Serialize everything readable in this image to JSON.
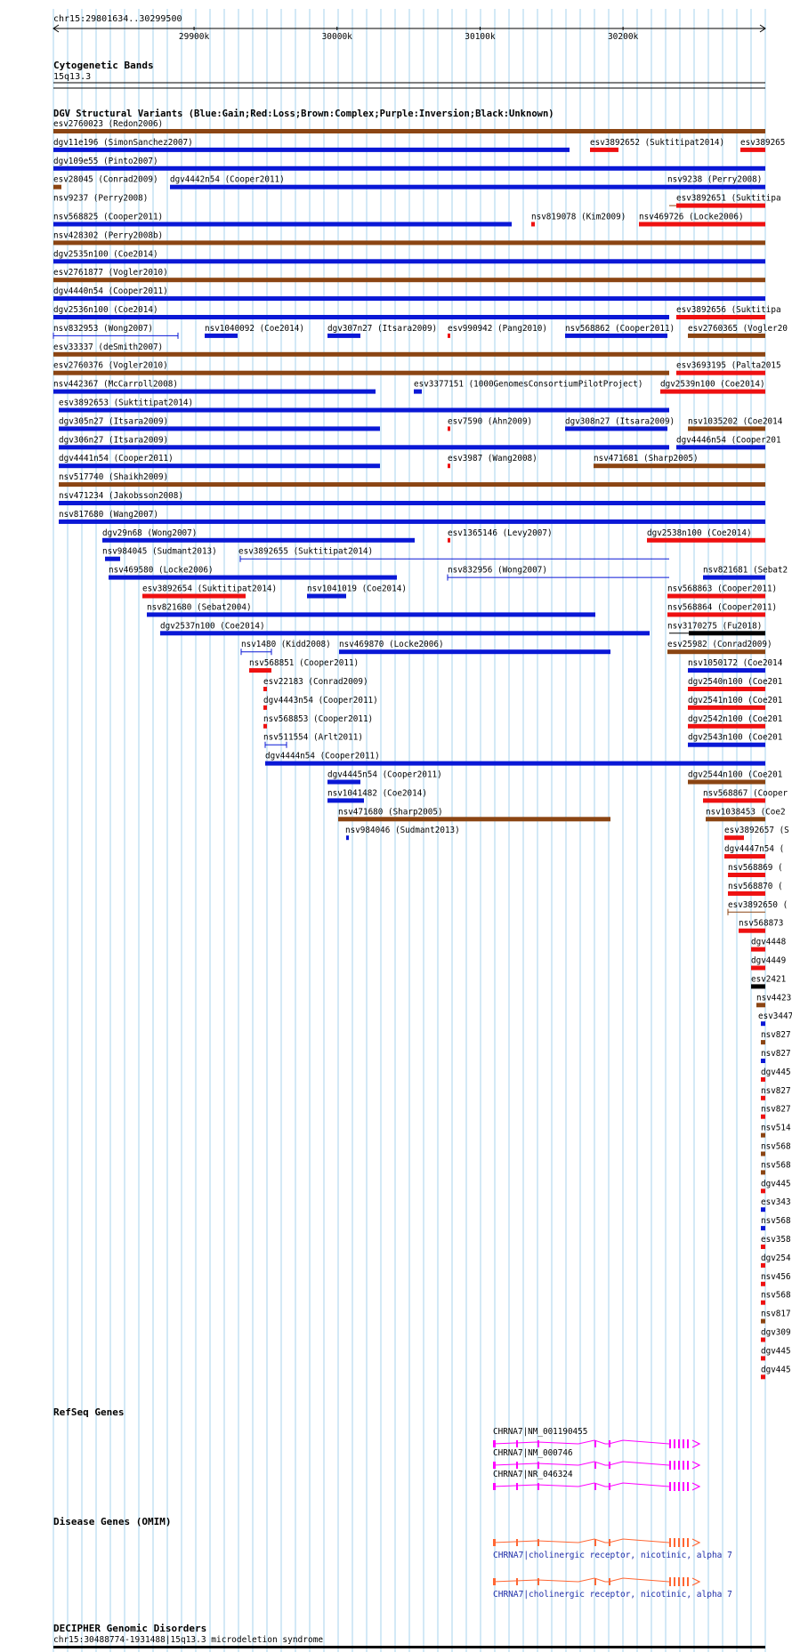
{
  "ruler": {
    "position_label": "chr15:29801634..30299500",
    "ticks": [
      {
        "label": "29900k",
        "value": 29900000
      },
      {
        "label": "30000k",
        "value": 30000000
      },
      {
        "label": "30100k",
        "value": 30100000
      },
      {
        "label": "30200k",
        "value": 30200000
      }
    ]
  },
  "tracks": {
    "cytoband": {
      "title": "Cytogenetic Bands",
      "label": "15q13.3"
    },
    "dgv": {
      "title": "DGV Structural Variants (Blue:Gain;Red:Loss;Brown:Complex;Purple:Inversion;Black:Unknown)"
    },
    "refseq": {
      "title": "RefSeq Genes"
    },
    "omim": {
      "title": "Disease Genes (OMIM)"
    },
    "decipher": {
      "title": "DECIPHER Genomic Disorders",
      "label": "chr15:30488774-1931488|15q13.3 microdeletion syndrome"
    }
  },
  "colors": {
    "gain": "#0a18d6",
    "loss": "#ee1111",
    "complex": "#8b4513",
    "unknown": "#000000",
    "refseq": "#ff00ff",
    "omim": "#ff6633",
    "omim_label": "#1f2fa8"
  },
  "variants": [
    {
      "label": "esv2760023 (Redon2006)",
      "type": "complex"
    },
    {
      "label": "dgv11e196 (SimonSanchez2007)",
      "type": "gain"
    },
    {
      "label": "esv3892652 (Suktitipat2014)",
      "type": "loss"
    },
    {
      "label": "esv389265",
      "type": "loss"
    },
    {
      "label": "dgv109e55 (Pinto2007)",
      "type": "gain"
    },
    {
      "label": "esv28045 (Conrad2009)",
      "type": "complex"
    },
    {
      "label": "dgv4442n54 (Cooper2011)",
      "type": "gain"
    },
    {
      "label": "nsv9238 (Perry2008)",
      "type": "gain"
    },
    {
      "label": "nsv9237 (Perry2008)",
      "type": "complex"
    },
    {
      "label": "esv3892651 (Suktitipa",
      "type": "loss"
    },
    {
      "label": "nsv568825 (Cooper2011)",
      "type": "gain"
    },
    {
      "label": "nsv819078 (Kim2009)",
      "type": "loss"
    },
    {
      "label": "nsv469726 (Locke2006)",
      "type": "loss"
    },
    {
      "label": "nsv428302 (Perry2008b)",
      "type": "complex"
    },
    {
      "label": "dgv2535n100 (Coe2014)",
      "type": "gain"
    },
    {
      "label": "esv2761877 (Vogler2010)",
      "type": "complex"
    },
    {
      "label": "dgv4440n54 (Cooper2011)",
      "type": "gain"
    },
    {
      "label": "dgv2536n100 (Coe2014)",
      "type": "gain"
    },
    {
      "label": "esv3892656 (Suktitipa",
      "type": "loss"
    },
    {
      "label": "nsv832953 (Wong2007)",
      "type": "gain"
    },
    {
      "label": "nsv1040092 (Coe2014)",
      "type": "gain"
    },
    {
      "label": "dgv307n27 (Itsara2009)",
      "type": "gain"
    },
    {
      "label": "esv990942 (Pang2010)",
      "type": "loss"
    },
    {
      "label": "nsv568862 (Cooper2011)",
      "type": "gain"
    },
    {
      "label": "esv2760365 (Vogler20",
      "type": "complex"
    },
    {
      "label": "esv33337 (deSmith2007)",
      "type": "complex"
    },
    {
      "label": "esv2760376 (Vogler2010)",
      "type": "complex"
    },
    {
      "label": "esv3693195 (Palta2015",
      "type": "loss"
    },
    {
      "label": "nsv442367 (McCarroll2008)",
      "type": "gain"
    },
    {
      "label": "esv3377151 (1000GenomesConsortiumPilotProject)",
      "type": "gain"
    },
    {
      "label": "dgv2539n100 (Coe2014)",
      "type": "loss"
    },
    {
      "label": "esv3892653 (Suktitipat2014)",
      "type": "gain"
    },
    {
      "label": "dgv305n27 (Itsara2009)",
      "type": "gain"
    },
    {
      "label": "esv7590 (Ahn2009)",
      "type": "loss"
    },
    {
      "label": "dgv308n27 (Itsara2009)",
      "type": "gain"
    },
    {
      "label": "nsv1035202 (Coe2014",
      "type": "complex"
    },
    {
      "label": "dgv306n27 (Itsara2009)",
      "type": "gain"
    },
    {
      "label": "dgv4446n54 (Cooper201",
      "type": "gain"
    },
    {
      "label": "dgv4441n54 (Cooper2011)",
      "type": "gain"
    },
    {
      "label": "esv3987 (Wang2008)",
      "type": "loss"
    },
    {
      "label": "nsv471681 (Sharp2005)",
      "type": "complex"
    },
    {
      "label": "nsv517740 (Shaikh2009)",
      "type": "complex"
    },
    {
      "label": "nsv471234 (Jakobsson2008)",
      "type": "gain"
    },
    {
      "label": "nsv817680 (Wang2007)",
      "type": "gain"
    },
    {
      "label": "dgv29n68 (Wong2007)",
      "type": "gain"
    },
    {
      "label": "esv1365146 (Levy2007)",
      "type": "loss"
    },
    {
      "label": "dgv2538n100 (Coe2014)",
      "type": "loss"
    },
    {
      "label": "nsv984045 (Sudmant2013)",
      "type": "gain"
    },
    {
      "label": "esv3892655 (Suktitipat2014)",
      "type": "gain"
    },
    {
      "label": "nsv469580 (Locke2006)",
      "type": "gain"
    },
    {
      "label": "nsv832956 (Wong2007)",
      "type": "gain"
    },
    {
      "label": "nsv821681 (Sebat2",
      "type": "gain"
    },
    {
      "label": "esv3892654 (Suktitipat2014)",
      "type": "loss"
    },
    {
      "label": "nsv1041019 (Coe2014)",
      "type": "gain"
    },
    {
      "label": "nsv568863 (Cooper2011)",
      "type": "loss"
    },
    {
      "label": "nsv821680 (Sebat2004)",
      "type": "gain"
    },
    {
      "label": "nsv568864 (Cooper2011)",
      "type": "loss"
    },
    {
      "label": "dgv2537n100 (Coe2014)",
      "type": "gain"
    },
    {
      "label": "nsv3170275 (Fu2018)",
      "type": "unknown"
    },
    {
      "label": "nsv1480 (Kidd2008)",
      "type": "gain"
    },
    {
      "label": "nsv469870 (Locke2006)",
      "type": "gain"
    },
    {
      "label": "esv25982 (Conrad2009)",
      "type": "complex"
    },
    {
      "label": "nsv568851 (Cooper2011)",
      "type": "loss"
    },
    {
      "label": "nsv1050172 (Coe2014",
      "type": "gain"
    },
    {
      "label": "esv22183 (Conrad2009)",
      "type": "loss"
    },
    {
      "label": "dgv2540n100 (Coe201",
      "type": "loss"
    },
    {
      "label": "dgv4443n54 (Cooper2011)",
      "type": "loss"
    },
    {
      "label": "dgv2541n100 (Coe201",
      "type": "loss"
    },
    {
      "label": "nsv568853 (Cooper2011)",
      "type": "loss"
    },
    {
      "label": "dgv2542n100 (Coe201",
      "type": "loss"
    },
    {
      "label": "nsv511554 (Arlt2011)",
      "type": "gain"
    },
    {
      "label": "dgv2543n100 (Coe201",
      "type": "gain"
    },
    {
      "label": "dgv4444n54 (Cooper2011)",
      "type": "gain"
    },
    {
      "label": "dgv4445n54 (Cooper2011)",
      "type": "gain"
    },
    {
      "label": "dgv2544n100 (Coe201",
      "type": "complex"
    },
    {
      "label": "nsv1041482 (Coe2014)",
      "type": "gain"
    },
    {
      "label": "nsv568867 (Cooper",
      "type": "loss"
    },
    {
      "label": "nsv471680 (Sharp2005)",
      "type": "complex"
    },
    {
      "label": "nsv1038453 (Coe2",
      "type": "complex"
    },
    {
      "label": "nsv984046 (Sudmant2013)",
      "type": "gain"
    },
    {
      "label": "esv3892657 (S",
      "type": "loss"
    },
    {
      "label": "dgv4447n54 (",
      "type": "loss"
    },
    {
      "label": "nsv568869 (",
      "type": "loss"
    },
    {
      "label": "nsv568870 (",
      "type": "loss"
    },
    {
      "label": "esv3892650 (",
      "type": "complex"
    },
    {
      "label": "nsv568873",
      "type": "loss"
    },
    {
      "label": "dgv4448",
      "type": "loss"
    },
    {
      "label": "dgv4449",
      "type": "loss"
    },
    {
      "label": "esv2421",
      "type": "unknown"
    },
    {
      "label": "nsv4423",
      "type": "complex"
    },
    {
      "label": "esv3447",
      "type": "gain"
    },
    {
      "label": "nsv827",
      "type": "complex"
    },
    {
      "label": "nsv827",
      "type": "gain"
    },
    {
      "label": "dgv445",
      "type": "loss"
    },
    {
      "label": "nsv827",
      "type": "loss"
    },
    {
      "label": "nsv827",
      "type": "loss"
    },
    {
      "label": "nsv514",
      "type": "complex"
    },
    {
      "label": "nsv568",
      "type": "complex"
    },
    {
      "label": "nsv568",
      "type": "complex"
    },
    {
      "label": "dgv445",
      "type": "loss"
    },
    {
      "label": "esv343",
      "type": "gain"
    },
    {
      "label": "nsv568",
      "type": "gain"
    },
    {
      "label": "esv358",
      "type": "loss"
    },
    {
      "label": "dgv254",
      "type": "loss"
    },
    {
      "label": "nsv456",
      "type": "loss"
    },
    {
      "label": "nsv568",
      "type": "loss"
    },
    {
      "label": "nsv817",
      "type": "complex"
    },
    {
      "label": "dgv309",
      "type": "loss"
    },
    {
      "label": "dgv445",
      "type": "loss"
    },
    {
      "label": "dgv445",
      "type": "loss"
    }
  ],
  "genes": [
    {
      "label": "CHRNA7|NM_001190455"
    },
    {
      "label": "CHRNA7|NM_000746"
    },
    {
      "label": "CHRNA7|NR_046324"
    }
  ],
  "omim": [
    {
      "label": "CHRNA7|cholinergic receptor, nicotinic, alpha 7"
    },
    {
      "label": "CHRNA7|cholinergic receptor, nicotinic, alpha 7"
    }
  ]
}
